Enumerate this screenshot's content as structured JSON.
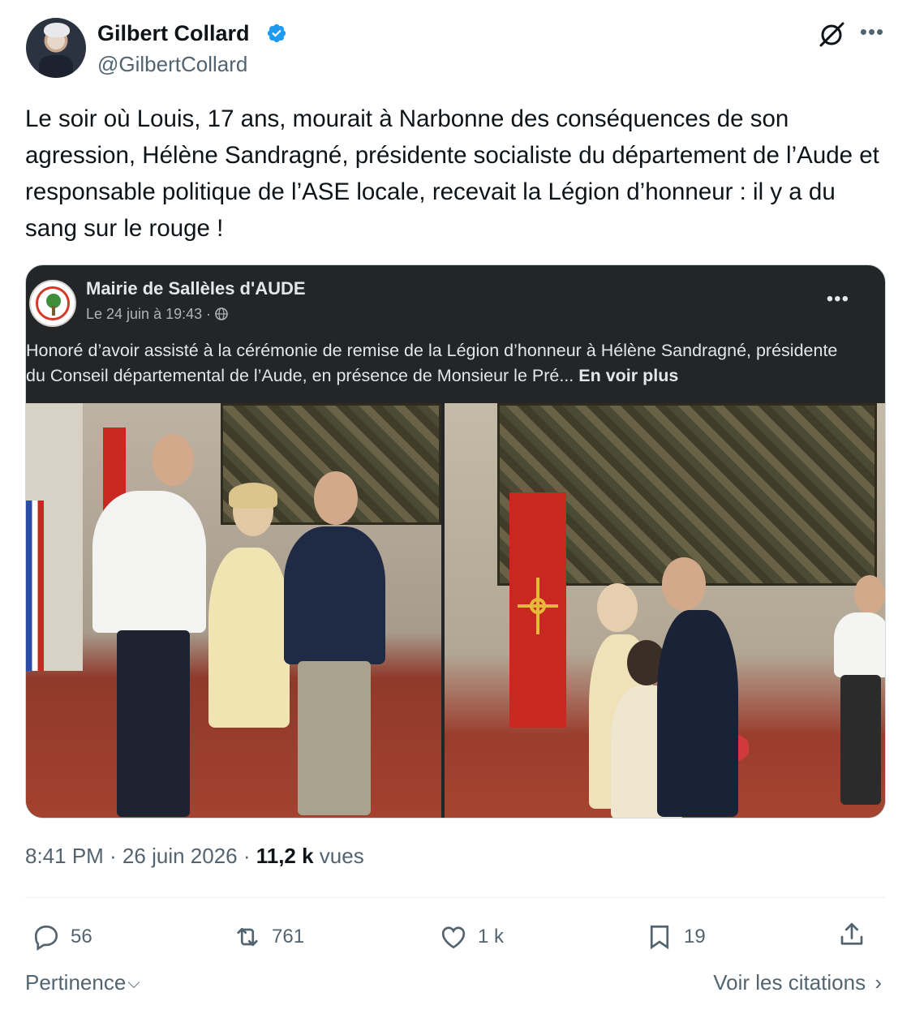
{
  "author": {
    "name": "Gilbert Collard",
    "handle": "@GilbertCollard",
    "verified_color": "#1d9bf0"
  },
  "icons": {
    "grok": "grok-icon",
    "more": "more-icon"
  },
  "tweet": {
    "text": "Le soir où Louis, 17 ans, mourait à Narbonne des conséquences de son agression, Hélène Sandragné, présidente socialiste du département de l’Aude et responsable politique de l’ASE locale, recevait la Légion d’honneur : il y a du sang sur le rouge !"
  },
  "embedded_post": {
    "page_name": "Mairie de Sallèles d'AUDE",
    "date": "Le 24 juin à 19:43 · ",
    "text": "Honoré d’avoir assisté à la cérémonie de remise de la Légion d’honneur à Hélène Sandragné, présidente du Conseil départemental de l’Aude, en présence de Monsieur le Pré... ",
    "see_more": "En voir plus",
    "more_glyph": "•••"
  },
  "meta": {
    "time_date": "8:41 PM · 26 juin 2026 · ",
    "views_count": "11,2 k",
    "views_label": " vues"
  },
  "actions": {
    "replies": "56",
    "reposts": "761",
    "likes": "1 k",
    "bookmarks": "19"
  },
  "footer": {
    "sort_label": "Pertinence",
    "quotes_label": "Voir les citations"
  }
}
